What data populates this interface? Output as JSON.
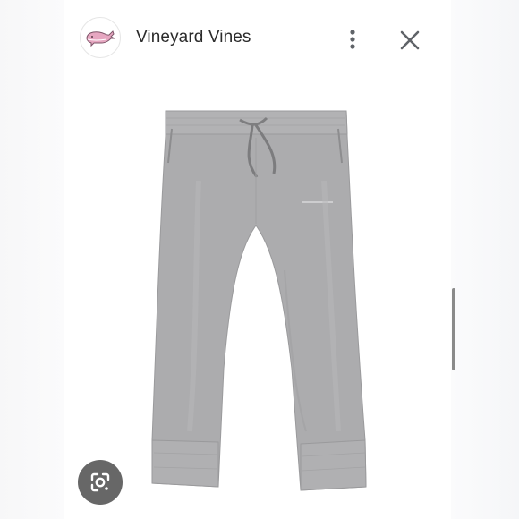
{
  "header": {
    "title": "Vineyard Vines",
    "logo_icon": "whale-logo-icon",
    "menu_icon": "more-vert-icon",
    "close_icon": "close-icon"
  },
  "image": {
    "subject_icon": "gray-jogger-pants",
    "color": "#a9a9ab"
  },
  "lens_button": {
    "icon": "google-lens-icon"
  },
  "colors": {
    "logo_whale": "#e0a3bd",
    "pants": "#a9a9ab",
    "lens_bg": "#4a4a4a"
  }
}
